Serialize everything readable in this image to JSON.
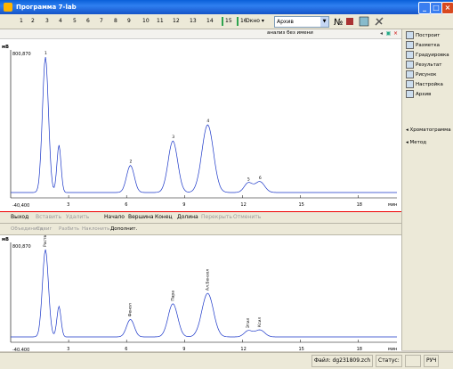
{
  "window": {
    "title": "Программа 7-lab"
  },
  "toolbar": {
    "numbers": [
      "1",
      "2",
      "3",
      "4",
      "5",
      "6",
      "7",
      "8",
      "9",
      "10",
      "11",
      "12",
      "13",
      "14",
      "15",
      "16"
    ],
    "okno_label": "Окно",
    "arkhiv_value": "Архив"
  },
  "sidebar": {
    "items": [
      {
        "label": "Построит",
        "icon": "chart-icon"
      },
      {
        "label": "Разметка",
        "icon": "markup-icon"
      },
      {
        "label": "Градуировка",
        "icon": "calibration-icon"
      },
      {
        "label": "Результат",
        "icon": "result-icon"
      },
      {
        "label": "Рисунок",
        "icon": "picture-icon"
      },
      {
        "label": "Настройка",
        "icon": "settings-icon"
      },
      {
        "label": "Архив",
        "icon": "archive-icon"
      }
    ],
    "section1": "Хроматограмма",
    "section2": "Метод"
  },
  "top_plot": {
    "header_label": "анализ без имени",
    "n_label": "мВ",
    "y_top": "800,870",
    "y_bottom": "-40,400",
    "x_ticks": [
      "3",
      "6",
      "9",
      "12",
      "15",
      "18"
    ],
    "x_unit": "мин",
    "peak_labels": [
      "1",
      "2",
      "3",
      "4",
      "5",
      "6"
    ]
  },
  "ctrlbar": {
    "items": [
      {
        "label": "Выход",
        "enabled": true
      },
      {
        "label": "Вставить",
        "enabled": false
      },
      {
        "label": "Удалить",
        "enabled": false
      },
      {
        "label": "Начало",
        "enabled": true
      },
      {
        "label": "Вершина",
        "enabled": true
      },
      {
        "label": "Конец",
        "enabled": true
      },
      {
        "label": "Долина",
        "enabled": true
      },
      {
        "label": "Перекрыть",
        "enabled": false
      },
      {
        "label": "Отменить",
        "enabled": false
      }
    ]
  },
  "ctrlbar2": {
    "items": [
      {
        "label": "Объединить",
        "enabled": false
      },
      {
        "label": "Сдвиг",
        "enabled": false
      },
      {
        "label": "Разбить",
        "enabled": false
      },
      {
        "label": "Наклонить",
        "enabled": false
      },
      {
        "label": "Дополнит.",
        "enabled": true
      }
    ]
  },
  "bottom_plot": {
    "n_label": "мВ",
    "y_top": "800,870",
    "y_bottom": "-40,400",
    "x_ticks": [
      "3",
      "6",
      "9",
      "12",
      "15",
      "18"
    ],
    "x_unit": "мин",
    "peak_labels": [
      "Раств",
      "Фенол",
      "Пара",
      "Ал.Бензол",
      "Этил",
      "Ксил"
    ]
  },
  "statusbar": {
    "file": "Файл: dg231809.zch",
    "status_label": "Статус:",
    "mode": "РУЧ"
  }
}
